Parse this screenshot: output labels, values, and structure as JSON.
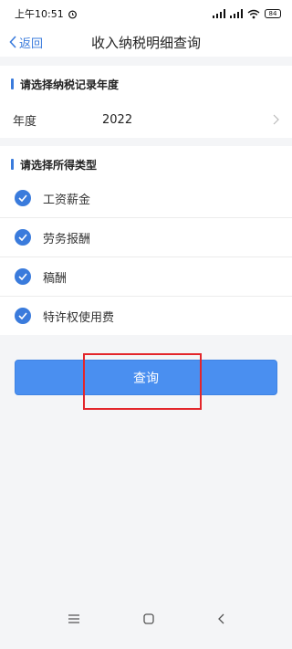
{
  "status_bar": {
    "time": "上午10:51",
    "battery": "84"
  },
  "nav": {
    "back_label": "返回",
    "title": "收入纳税明细查询"
  },
  "year_section": {
    "heading": "请选择纳税记录年度",
    "field_label": "年度",
    "field_value": "2022"
  },
  "type_section": {
    "heading": "请选择所得类型",
    "options": [
      {
        "label": "工资薪金",
        "checked": true
      },
      {
        "label": "劳务报酬",
        "checked": true
      },
      {
        "label": "稿酬",
        "checked": true
      },
      {
        "label": "特许权使用费",
        "checked": true
      }
    ]
  },
  "query_button": {
    "label": "查询"
  },
  "colors": {
    "accent": "#3a7bdc",
    "button": "#4a8ff0",
    "highlight": "#e3262b"
  }
}
